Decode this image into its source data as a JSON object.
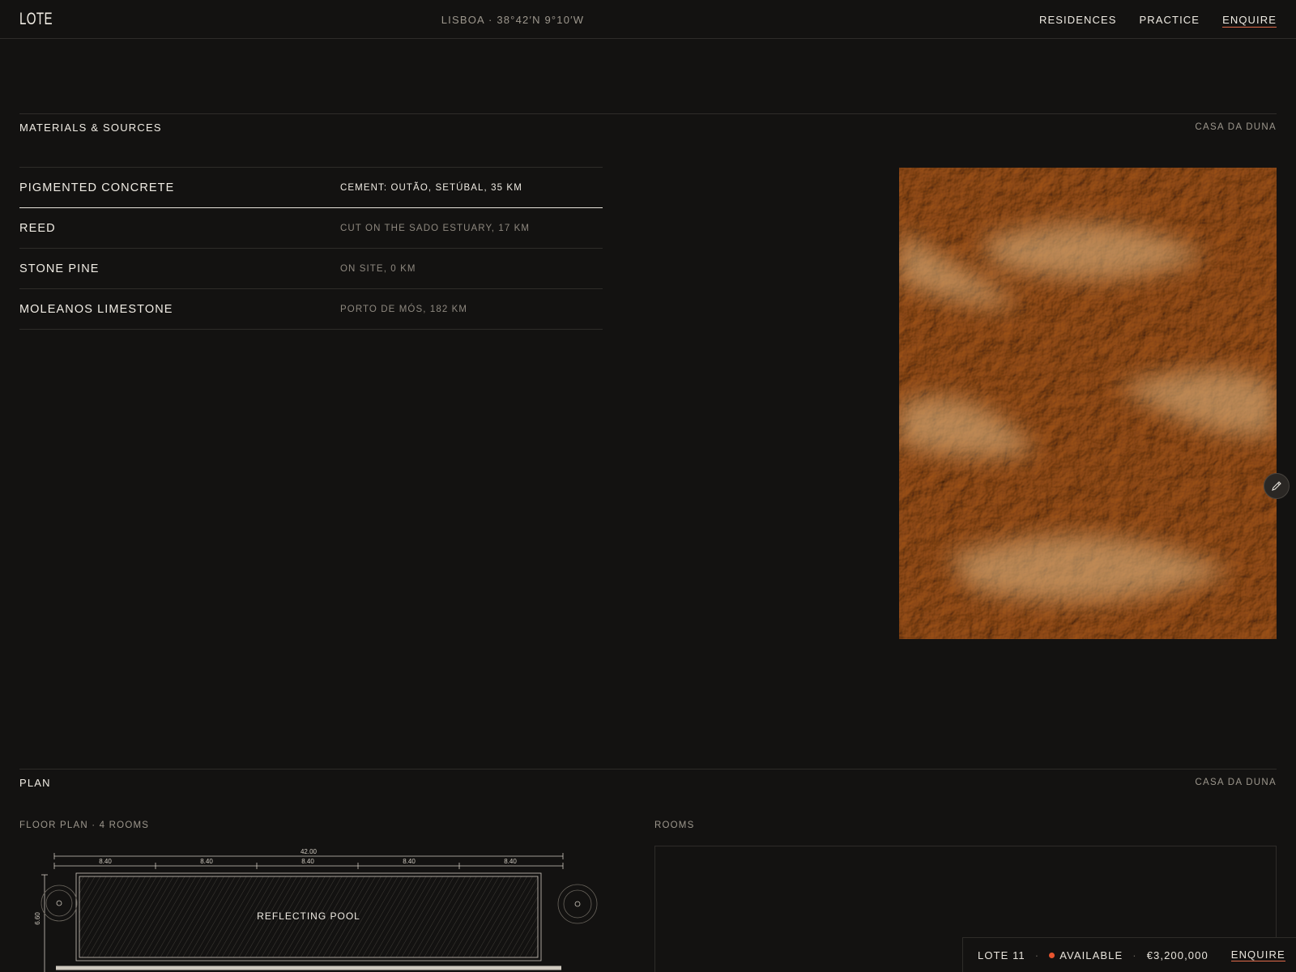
{
  "header": {
    "logo": "LOTE",
    "coords": "LISBOA · 38°42′N 9°10′W",
    "nav": [
      "RESIDENCES",
      "PRACTICE",
      "ENQUIRE"
    ]
  },
  "materials_section": {
    "title": "MATERIALS & SOURCES",
    "meta": "CASA DA DUNA",
    "items": [
      {
        "name": "PIGMENTED CONCRETE",
        "source": "CEMENT: OUTÃO, SETÚBAL, 35 KM"
      },
      {
        "name": "REED",
        "source": "CUT ON THE SADO ESTUARY, 17 KM"
      },
      {
        "name": "STONE PINE",
        "source": "ON SITE, 0 KM"
      },
      {
        "name": "MOLEANOS LIMESTONE",
        "source": "PORTO DE MÓS, 182 KM"
      }
    ],
    "active_index": 0
  },
  "plan_section": {
    "title": "PLAN",
    "meta": "CASA DA DUNA",
    "floor_label": "FLOOR PLAN · 4 ROOMS",
    "rooms_label": "ROOMS",
    "drawing": {
      "overall": "42.00",
      "bays": [
        "8.40",
        "8.40",
        "8.40",
        "8.40",
        "8.40"
      ],
      "depth": "6.60",
      "pool_label": "REFLECTING POOL"
    }
  },
  "bottom_bar": {
    "lot": "LOTE 11",
    "status": "AVAILABLE",
    "price": "€3,200,000",
    "cta": "ENQUIRE"
  },
  "colors": {
    "background": "#131211",
    "text": "#f0ece4",
    "muted": "#9d978d",
    "accent": "#e8552f",
    "texture": "#b07a42"
  },
  "icons": [
    "pencil-icon",
    "status-dot-icon",
    "tree-icon"
  ]
}
